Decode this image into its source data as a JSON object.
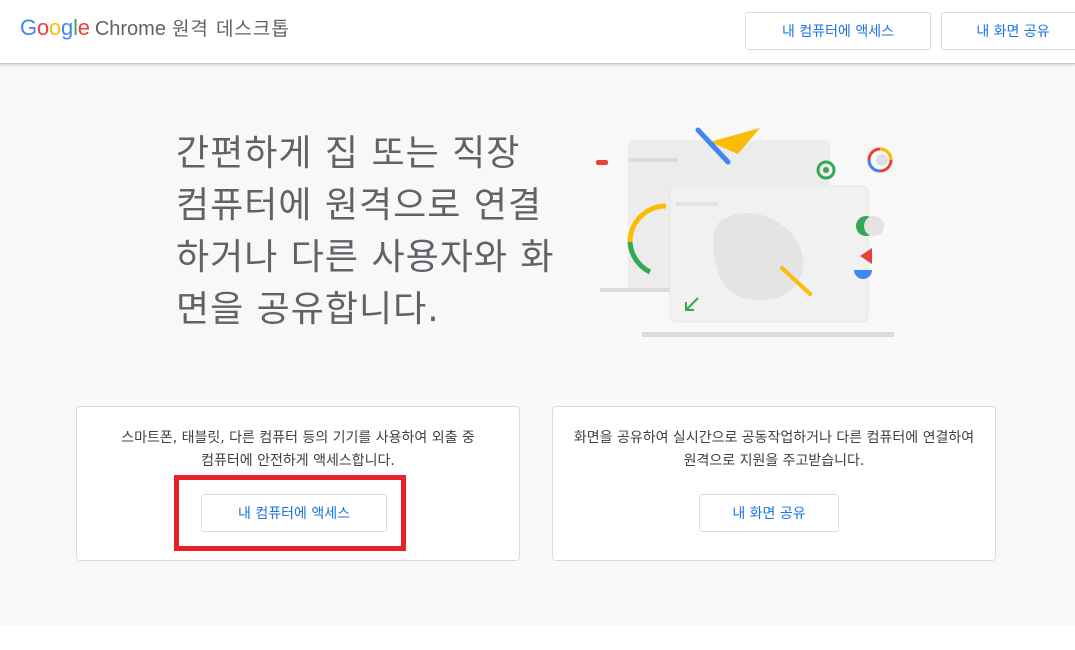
{
  "header": {
    "logo": {
      "letters": [
        "G",
        "o",
        "o",
        "g",
        "l",
        "e"
      ],
      "letter_colors": [
        "#4285F4",
        "#EA4335",
        "#FBBC05",
        "#4285F4",
        "#34A853",
        "#EA4335"
      ],
      "product": "Chrome",
      "title": "원격 데스크톱"
    },
    "access_button_label": "내 컴퓨터에 액세스",
    "share_button_label": "내 화면 공유"
  },
  "hero": {
    "lines": [
      "간편하게 집 또는 직장",
      "컴퓨터에 원격으로 연결",
      "하거나 다른 사용자와 화",
      "면을 공유합니다."
    ]
  },
  "cards": {
    "access": {
      "description": "스마트폰, 태블릿, 다른 컴퓨터 등의 기기를 사용하여 외출 중 컴퓨터에 안전하게 액세스합니다.",
      "button_label": "내 컴퓨터에 액세스"
    },
    "share": {
      "description": "화면을 공유하여 실시간으로 공동작업하거나 다른 컴퓨터에 연결하여 원격으로 지원을 주고받습니다.",
      "button_label": "내 화면 공유"
    }
  },
  "colors": {
    "accent": "#1a73e8",
    "highlight": "#e8202a",
    "google_blue": "#4285F4",
    "google_red": "#EA4335",
    "google_yellow": "#FBBC05",
    "google_green": "#34A853"
  }
}
